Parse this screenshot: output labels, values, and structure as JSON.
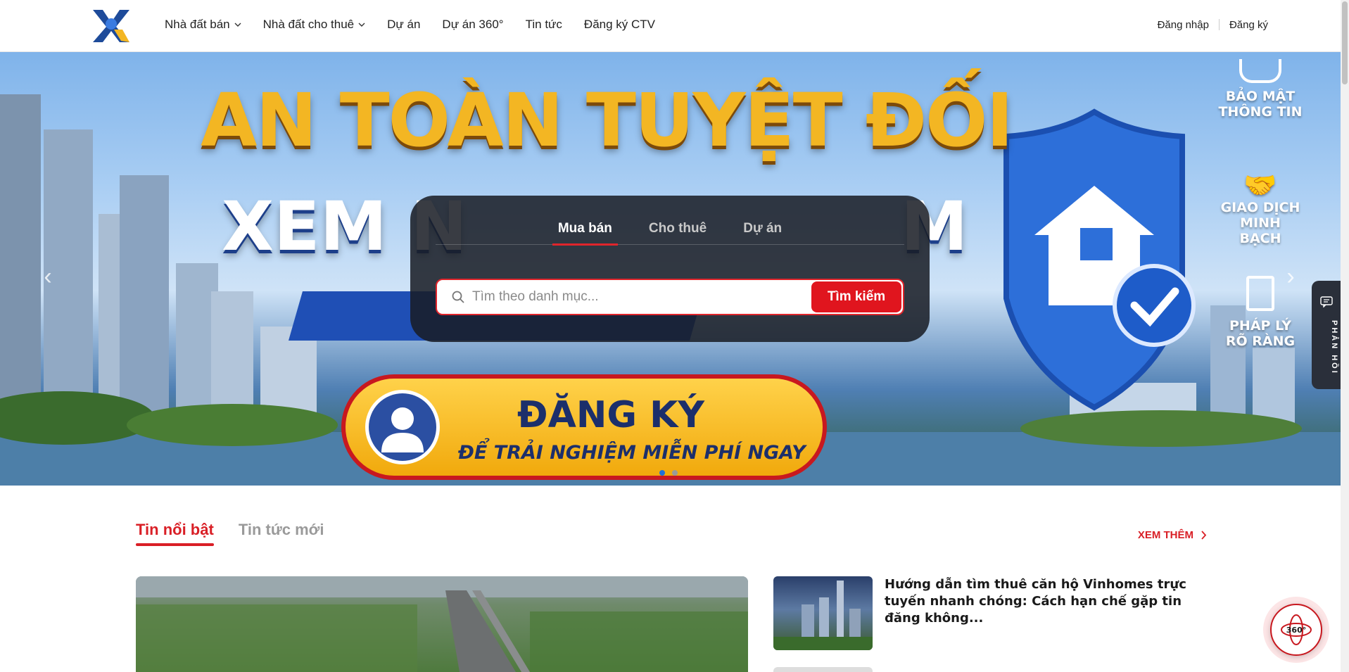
{
  "header": {
    "nav": [
      {
        "label": "Nhà đất bán",
        "has_dropdown": true
      },
      {
        "label": "Nhà đất cho thuê",
        "has_dropdown": true
      },
      {
        "label": "Dự án",
        "has_dropdown": false
      },
      {
        "label": "Dự án 360°",
        "has_dropdown": false
      },
      {
        "label": "Tin tức",
        "has_dropdown": false
      },
      {
        "label": "Đăng ký CTV",
        "has_dropdown": false
      }
    ],
    "login": "Đăng nhập",
    "register": "Đăng ký"
  },
  "hero": {
    "title1": "AN TOÀN TUYỆT ĐỐI",
    "title2": "XEM N",
    "title2_right": "M",
    "cta_line1": "ĐĂNG KÝ",
    "cta_line2": "ĐỂ TRẢI NGHIỆM MIỄN PHÍ NGAY",
    "features": [
      {
        "label": "BẢO MẬT THÔNG TIN"
      },
      {
        "label": "GIAO DỊCH MINH BẠCH"
      },
      {
        "label": "PHÁP LÝ RÕ RÀNG"
      }
    ],
    "slides_total": 2,
    "slide_active": 1
  },
  "search": {
    "tabs": [
      "Mua bán",
      "Cho thuê",
      "Dự án"
    ],
    "active_tab": "Mua bán",
    "placeholder": "Tìm theo danh mục...",
    "button": "Tìm kiếm"
  },
  "feedback": {
    "label": "PHẢN HỒI"
  },
  "news": {
    "tabs": [
      "Tin nổi bật",
      "Tin tức mới"
    ],
    "active_tab": "Tin nổi bật",
    "see_more": "XEM THÊM",
    "items": [
      {
        "title": "Hướng dẫn tìm thuê căn hộ Vinhomes trực tuyến nhanh chóng: Cách hạn chế gặp tin đăng không..."
      }
    ]
  },
  "fab": {
    "label": "360°"
  },
  "colors": {
    "accent": "#e0151e",
    "hero_gold": "#f3b623",
    "dark_panel": "#181c24"
  }
}
